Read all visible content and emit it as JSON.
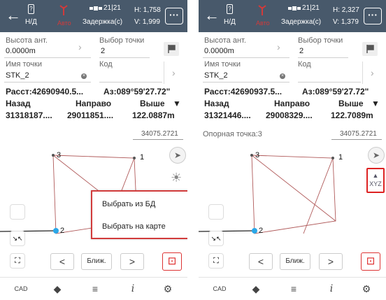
{
  "status": {
    "nd": "Н/Д",
    "mode": "Авто",
    "sat": "21|21",
    "delay": "Задержка(с)"
  },
  "p1": {
    "h": "H: 1,758",
    "v": "V: 1,999",
    "rasst": "Расст:42690940.5...",
    "az": "Аз:089°59'27.72\"",
    "nazad_val": "31318187....",
    "naprav_val": "29011851....",
    "vyshe_val": "122.0887m",
    "scale": "34075.2721"
  },
  "p2": {
    "h": "H: 2,327",
    "v": "V: 1,379",
    "rasst": "Расст:42690937.5...",
    "az": "Аз:089°59'27.72\"",
    "nazad_val": "31321446....",
    "naprav_val": "29008329....",
    "vyshe_val": "122.7089m",
    "scale": "34075.2721",
    "opor": "Опорная точка:3"
  },
  "form": {
    "height_label": "Высота ант.",
    "height_val": "0.0000m",
    "choose_label": "Выбор точки",
    "choose_val": "2",
    "name_label": "Имя точки",
    "name_val": "STK_2",
    "code_label": "Код",
    "nazad": "Назад",
    "naprav": "Направо",
    "vyshe": "Выше"
  },
  "map": {
    "p3": "3",
    "p1": "1",
    "p2": "2"
  },
  "popup": {
    "from_db": "Выбрать из БД",
    "on_map": "Выбрать на карте"
  },
  "nav": {
    "prev": "<",
    "near": "Ближ.",
    "next": ">"
  },
  "xyz": "XYZ",
  "colors": {
    "topbar": "#48596b",
    "accent_red": "#d13b3b",
    "point_blue": "#2aa7e8"
  }
}
